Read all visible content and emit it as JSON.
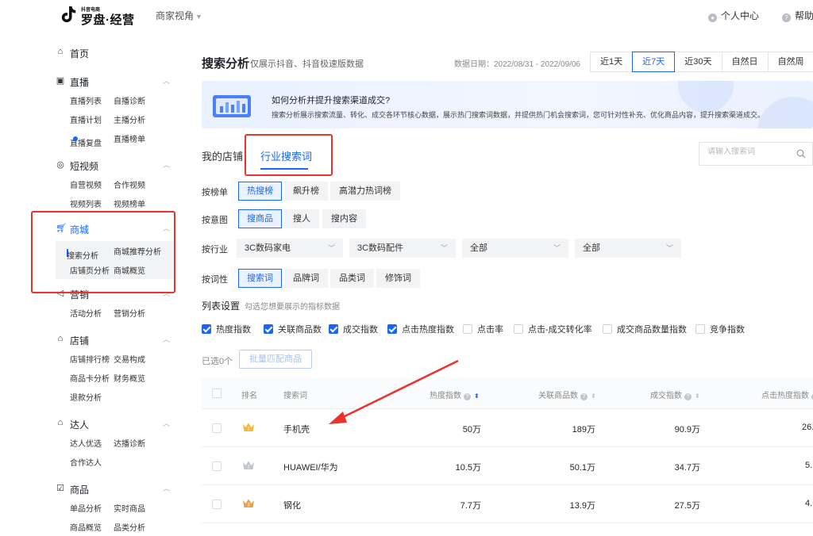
{
  "topbar": {
    "logo_small": "抖音电商",
    "logo_big": "罗盘·经营",
    "merchant_view": "商家视角",
    "personal_center": "个人中心",
    "help": "帮助"
  },
  "sidebar": {
    "home": "首页",
    "groups": [
      {
        "title": "直播",
        "items": [
          "直播列表",
          "自播诊断",
          "直播计划",
          "主播分析",
          "直播复盘",
          "直播榜单"
        ]
      },
      {
        "title": "短视频",
        "items": [
          "自营视频",
          "合作视频",
          "视频列表",
          "视频榜单"
        ]
      },
      {
        "title": "商城",
        "items": [
          "搜索分析",
          "商城推荐分析",
          "店铺页分析",
          "商城概览"
        ]
      },
      {
        "title": "营销",
        "items": [
          "活动分析",
          "营销分析"
        ]
      },
      {
        "title": "店铺",
        "items": [
          "店铺排行榜",
          "交易构成",
          "商品卡分析",
          "财务概览",
          "退款分析"
        ]
      },
      {
        "title": "达人",
        "items": [
          "达人优选",
          "达播诊断",
          "合作达人"
        ]
      },
      {
        "title": "商品",
        "items": [
          "单品分析",
          "实时商品",
          "商品概览",
          "品类分析"
        ]
      }
    ]
  },
  "header": {
    "title": "搜索分析",
    "subtitle": "仅展示抖音、抖音极速版数据",
    "date_range": "数据日期：2022/08/31 - 2022/09/06",
    "range_tabs": [
      "近1天",
      "近7天",
      "近30天",
      "自然日",
      "自然周"
    ]
  },
  "banner": {
    "title": "如何分析并提升搜索渠道成交?",
    "desc": "搜索分析展示搜索流量、转化、成交各环节核心数据，展示热门搜索词数据，并提供热门机会搜索词，您可针对性补充、优化商品内容，提升搜索渠道成交。"
  },
  "tabs": [
    "我的店铺",
    "行业搜索词"
  ],
  "search": {
    "placeholder": "请输入搜索词"
  },
  "filters": {
    "rank_label": "按榜单",
    "rank_options": [
      "热搜榜",
      "飙升榜",
      "高潜力热词榜"
    ],
    "intent_label": "按意图",
    "intent_options": [
      "搜商品",
      "搜人",
      "搜内容"
    ],
    "industry_label": "按行业",
    "industry_selects": [
      "3C数码家电",
      "3C数码配件",
      "全部",
      "全部"
    ],
    "wordtype_label": "按词性",
    "wordtype_options": [
      "搜索词",
      "品牌词",
      "品类词",
      "修饰词"
    ]
  },
  "list_settings": {
    "title": "列表设置",
    "subtitle": "勾选您想要展示的指标数据",
    "metrics": [
      {
        "label": "热度指数",
        "checked": true
      },
      {
        "label": "关联商品数",
        "checked": true
      },
      {
        "label": "成交指数",
        "checked": true
      },
      {
        "label": "点击热度指数",
        "checked": true
      },
      {
        "label": "点击率",
        "checked": false
      },
      {
        "label": "点击-成交转化率",
        "checked": false
      },
      {
        "label": "成交商品数量指数",
        "checked": false
      },
      {
        "label": "竞争指数",
        "checked": false
      }
    ]
  },
  "selection": {
    "count_text": "已选0个",
    "batch_button": "批量匹配商品"
  },
  "table": {
    "headers": [
      "排名",
      "搜索词",
      "热度指数",
      "关联商品数",
      "成交指数",
      "点击热度指数"
    ],
    "rows": [
      {
        "rank": "1",
        "keyword": "手机壳",
        "heat": "50万",
        "products": "189万",
        "deal": "90.9万",
        "click": "26."
      },
      {
        "rank": "2",
        "keyword": "HUAWEI/华为",
        "heat": "10.5万",
        "products": "50.1万",
        "deal": "34.7万",
        "click": "5."
      },
      {
        "rank": "3",
        "keyword": "钢化",
        "heat": "7.7万",
        "products": "13.9万",
        "deal": "27.5万",
        "click": "4."
      }
    ]
  },
  "colors": {
    "accent": "#1966ff",
    "highlight": "#e8342c",
    "gold": "#f5b82e",
    "silver": "#c0c4cc",
    "bronze": "#e8a04a"
  },
  "icons": [
    "home-icon",
    "live-icon",
    "video-icon",
    "cart-icon",
    "marketing-icon",
    "shop-icon",
    "talent-icon",
    "product-icon",
    "search-icon",
    "question-icon",
    "crown-icon"
  ]
}
